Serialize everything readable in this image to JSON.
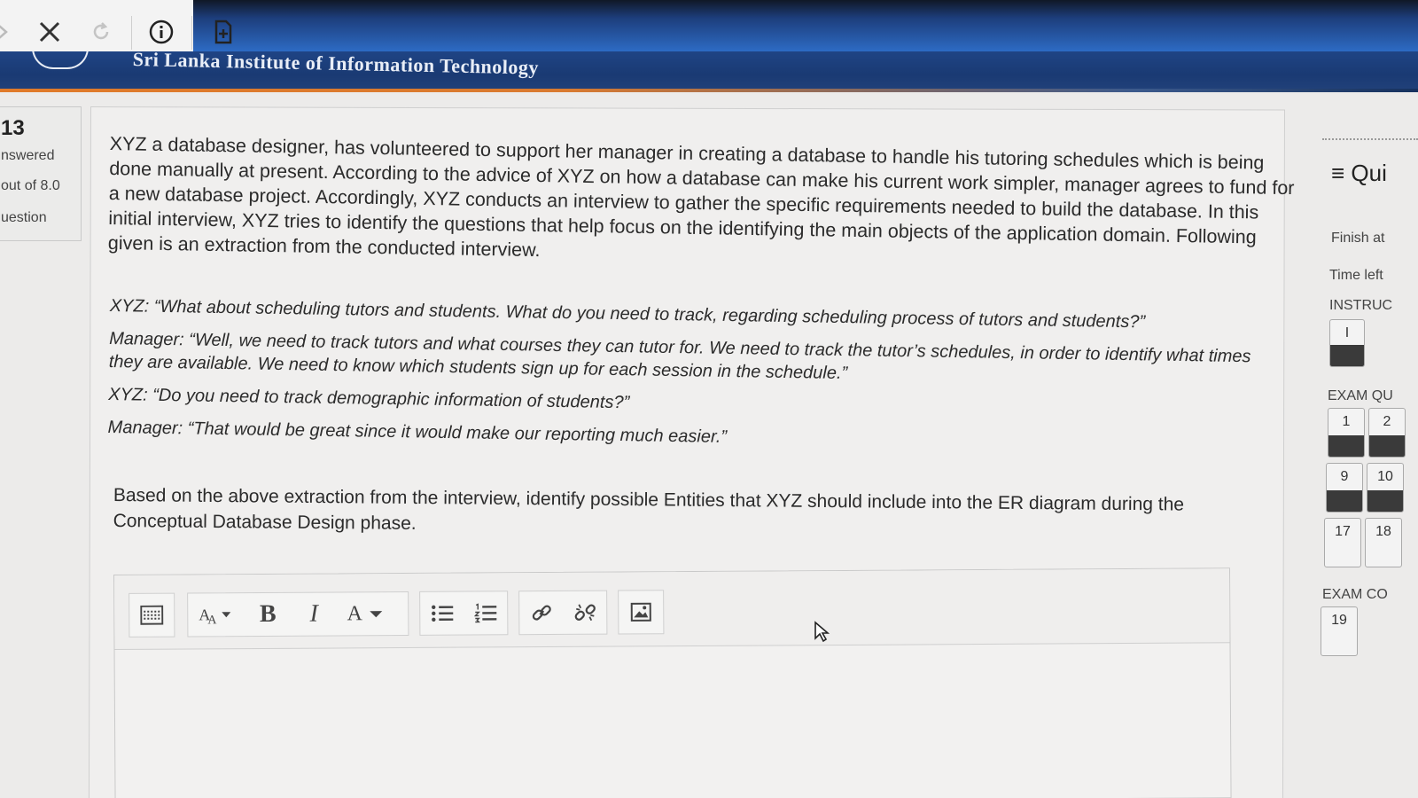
{
  "browser": {
    "close_icon": "close-icon",
    "reload_icon": "reload-icon",
    "info_icon": "info-icon",
    "page_icon": "add-page-icon"
  },
  "header": {
    "title": "Sri Lanka Institute of Information Technology"
  },
  "question_info": {
    "number": "13",
    "status": "nswered",
    "marks": "out of 8.0",
    "flag": "uestion"
  },
  "question": {
    "paragraph": [
      "XYZ a database designer, has volunteered to support her manager in creating a database to handle his tutoring schedules which is being",
      "done manually at present. According to the advice of XYZ on how a database can make his current work simpler, manager agrees to fund for",
      "a new database project. Accordingly, XYZ conducts an interview to gather the specific requirements needed to build the database. In this",
      "initial interview, XYZ tries to identify the questions that help focus on the identifying the main objects of the application domain. Following",
      "given is an extraction from the conducted interview."
    ],
    "dialog": [
      [
        "XYZ: “What about scheduling tutors and students. What do you need to track, regarding scheduling   process of tutors and students?”"
      ],
      [
        "Manager: “Well, we need to track tutors and what courses they can tutor for. We need to track the tutor’s schedules, in order to identify what times",
        "they are available. We need to know which students sign up for each session in the schedule.”"
      ],
      [
        "XYZ: “Do you need to track demographic information of students?”"
      ],
      [
        "Manager: “That would be great since it would make our reporting much easier.”"
      ]
    ],
    "ask": [
      "Based on the above extraction from the interview, identify possible Entities that XYZ should include into the ER diagram during the",
      "Conceptual Database Design phase."
    ]
  },
  "editor": {
    "buttons": {
      "toggle_toolbar": "keyboard-toolbar-icon",
      "font_size": "font-size-icon",
      "bold": "B",
      "italic": "I",
      "font_color": "A",
      "bullet_list": "bullet-list-icon",
      "numbered_list": "numbered-list-icon",
      "link": "link-icon",
      "unlink": "unlink-icon",
      "image": "image-icon"
    },
    "content": ""
  },
  "quiz_nav": {
    "title": "≡ Qui",
    "finish": "Finish at",
    "time_left": "Time left",
    "instructions": "INSTRUC",
    "instr_button": "I",
    "exam_q": "EXAM QU",
    "rows": [
      [
        "1",
        "2"
      ],
      [
        "9",
        "10"
      ],
      [
        "17",
        "18"
      ]
    ],
    "exam_co": "EXAM CO",
    "exam_co_item": "19"
  }
}
